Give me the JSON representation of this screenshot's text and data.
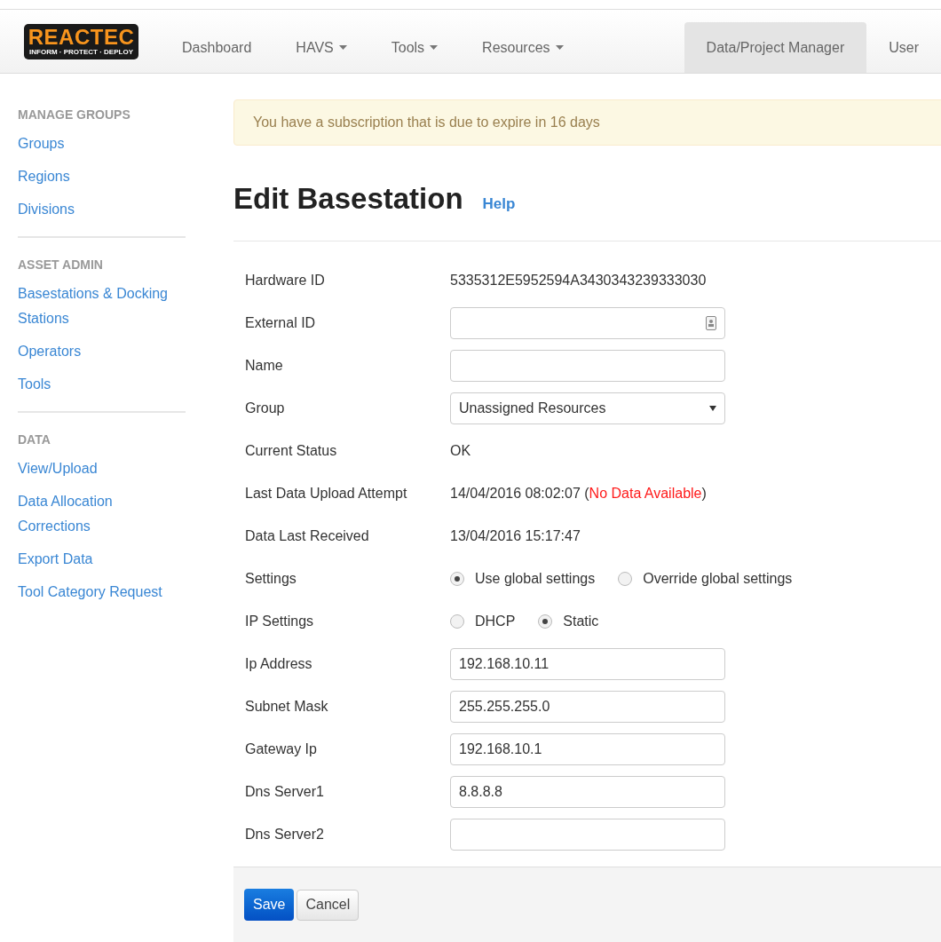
{
  "logo": {
    "name": "REACTEC",
    "tagline": "INFORM · PROTECT · DEPLOY"
  },
  "nav": [
    {
      "label": "Dashboard",
      "dropdown": false,
      "selected": false
    },
    {
      "label": "HAVS",
      "dropdown": true,
      "selected": false
    },
    {
      "label": "Tools",
      "dropdown": true,
      "selected": false
    },
    {
      "label": "Resources",
      "dropdown": true,
      "selected": false
    },
    {
      "label": "Data/Project Manager",
      "dropdown": false,
      "selected": true
    },
    {
      "label": "User",
      "dropdown": false,
      "selected": false
    }
  ],
  "sidebar": [
    {
      "heading": "MANAGE GROUPS",
      "items": [
        "Groups",
        "Regions",
        "Divisions"
      ]
    },
    {
      "heading": "ASSET ADMIN",
      "items": [
        "Basestations & Docking Stations",
        "Operators",
        "Tools"
      ]
    },
    {
      "heading": "DATA",
      "items": [
        "View/Upload",
        "Data Allocation Corrections",
        "Export Data",
        "Tool Category Request"
      ]
    }
  ],
  "alert": "You have a subscription that is due to expire in 16 days",
  "page": {
    "title": "Edit Basestation",
    "help": "Help"
  },
  "fields": [
    {
      "kind": "text",
      "label": "Hardware ID",
      "value": "5335312E5952594A3430343239333030"
    },
    {
      "kind": "input",
      "label": "External ID",
      "contact_icon": true
    },
    {
      "kind": "input",
      "label": "Name"
    },
    {
      "kind": "select",
      "label": "Group",
      "value": "Unassigned Resources"
    },
    {
      "kind": "text",
      "label": "Current Status",
      "value": "OK"
    },
    {
      "kind": "alerttext",
      "label": "Last Data Upload Attempt",
      "prefix": "14/04/2016 08:02:07 (",
      "alert": "No Data Available",
      "suffix": ")"
    },
    {
      "kind": "text",
      "label": "Data Last Received",
      "value": "13/04/2016 15:17:47"
    },
    {
      "kind": "radio",
      "label": "Settings",
      "options": [
        {
          "label": "Use global settings",
          "selected": true
        },
        {
          "label": "Override global settings",
          "selected": false
        }
      ]
    },
    {
      "kind": "radio",
      "label": "IP Settings",
      "options": [
        {
          "label": "DHCP",
          "selected": false
        },
        {
          "label": "Static",
          "selected": true
        }
      ]
    },
    {
      "kind": "input",
      "label": "Ip Address",
      "value": "192.168.10.11"
    },
    {
      "kind": "input",
      "label": "Subnet Mask",
      "value": "255.255.255.0"
    },
    {
      "kind": "input",
      "label": "Gateway Ip",
      "value": "192.168.10.1"
    },
    {
      "kind": "input",
      "label": "Dns Server1",
      "value": "8.8.8.8"
    },
    {
      "kind": "input",
      "label": "Dns Server2"
    }
  ],
  "buttons": [
    {
      "label": "Save",
      "primary": true
    },
    {
      "label": "Cancel",
      "primary": false
    }
  ]
}
